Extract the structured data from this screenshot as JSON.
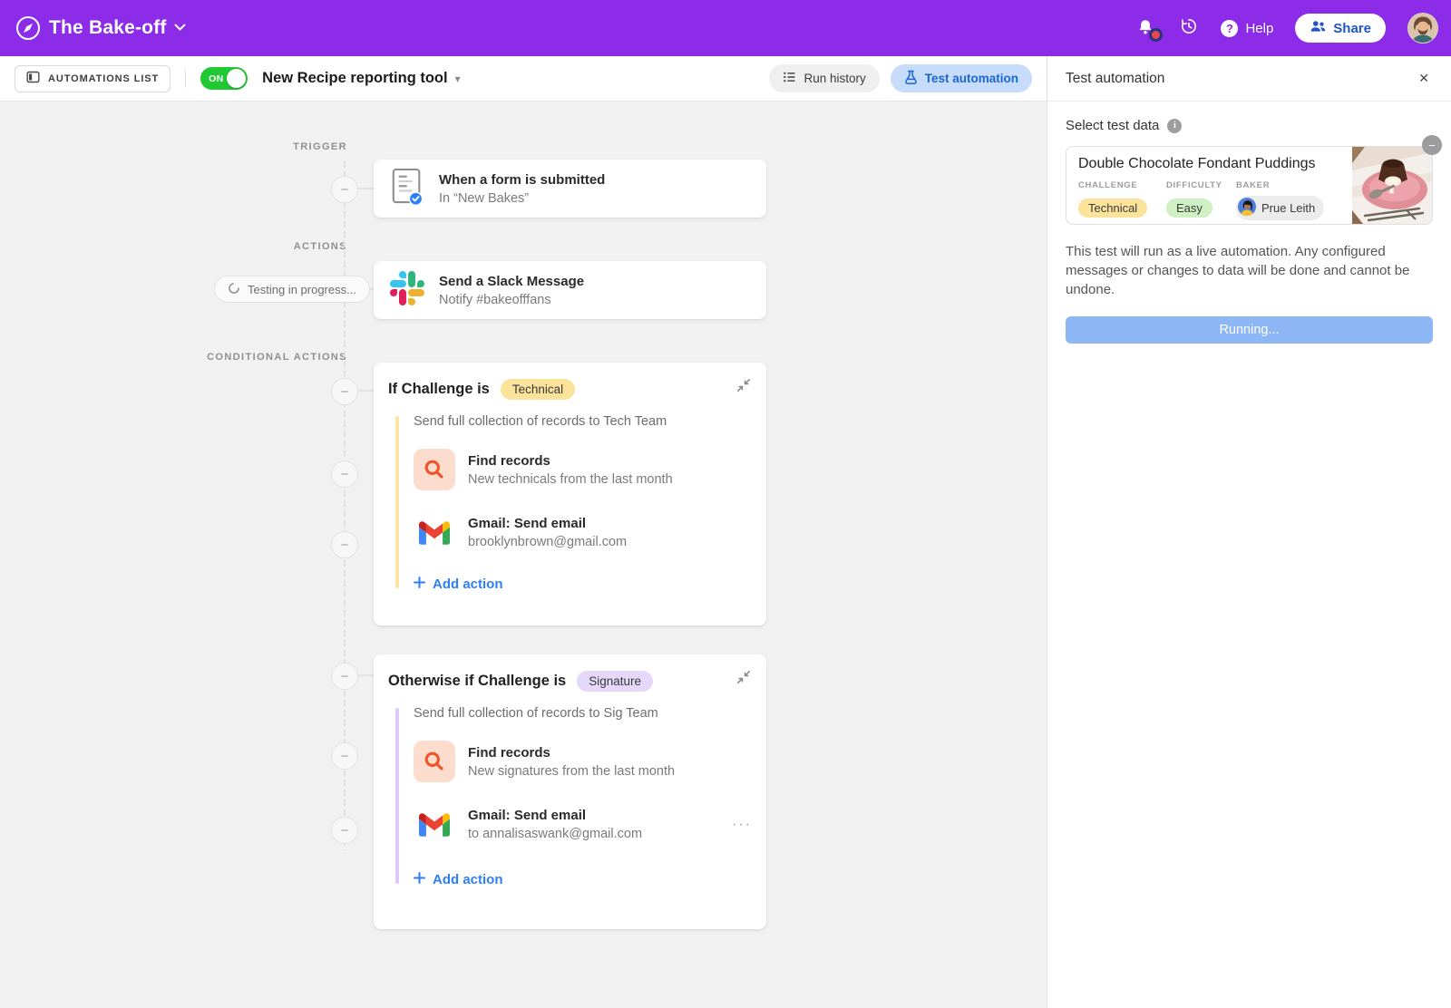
{
  "header": {
    "app_title": "The Bake-off",
    "help_label": "Help",
    "share_label": "Share"
  },
  "toolbar": {
    "automations_list": "AUTOMATIONS LIST",
    "toggle_on": "ON",
    "automation_name": "New Recipe reporting tool",
    "run_history": "Run history",
    "test_automation": "Test automation"
  },
  "flow": {
    "trigger_label": "TRIGGER",
    "actions_label": "ACTIONS",
    "conditional_label": "CONDITIONAL ACTIONS",
    "trigger": {
      "title": "When a form is submitted",
      "subtitle": "In “New Bakes”"
    },
    "testing_status": "Testing in progress...",
    "slack": {
      "title": "Send a Slack Message",
      "subtitle": "Notify #bakeofffans"
    },
    "if_card": {
      "title": "If Challenge is",
      "badge": "Technical",
      "description": "Send full collection of records to Tech Team",
      "steps": [
        {
          "title": "Find records",
          "subtitle": "New technicals from the last month"
        },
        {
          "title": "Gmail: Send email",
          "subtitle": "brooklynbrown@gmail.com"
        }
      ],
      "add_action": "Add action"
    },
    "otherwise_card": {
      "title": "Otherwise if Challenge is",
      "badge": "Signature",
      "description": "Send full collection of records to Sig Team",
      "steps": [
        {
          "title": "Find records",
          "subtitle": "New signatures from the last month"
        },
        {
          "title": "Gmail: Send email",
          "subtitle": "to annalisaswank@gmail.com"
        }
      ],
      "add_action": "Add action"
    }
  },
  "panel": {
    "title": "Test automation",
    "select_label": "Select test data",
    "record": {
      "title": "Double Chocolate Fondant Puddings",
      "field_labels": [
        "CHALLENGE",
        "DIFFICULTY",
        "BAKER"
      ],
      "challenge": "Technical",
      "difficulty": "Easy",
      "baker": "Prue Leith"
    },
    "warning": "This test will run as a live automation. Any configured messages or changes to data will be done and cannot be undone.",
    "run_button": "Running..."
  },
  "icons": {
    "minus": "−",
    "close": "✕",
    "ellipsis": "···",
    "caret_down": "▾",
    "question": "?",
    "info": "i"
  },
  "colors": {
    "header_purple": "#8C2BE8",
    "accent_blue": "#2d7ff9",
    "toggle_green": "#20c933",
    "badge_technical": "#fbe39b",
    "badge_easy": "#cff0c3",
    "badge_signature": "#e5d8fa",
    "running_button": "#8cb6f4"
  }
}
